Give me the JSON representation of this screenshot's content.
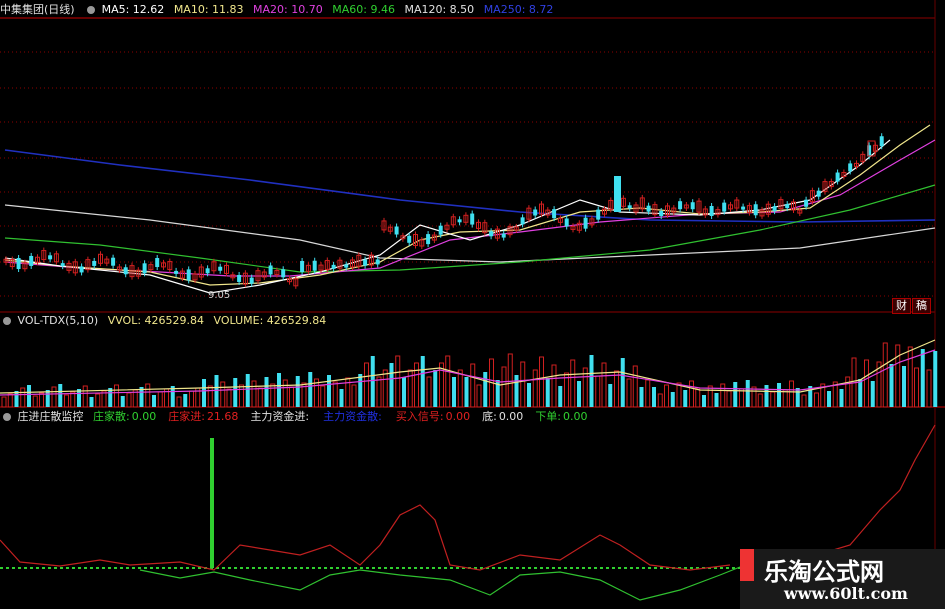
{
  "colors": {
    "ma5": "#ffffff",
    "ma10": "#f0e68c",
    "ma20": "#e040e0",
    "ma60": "#30c030",
    "ma120": "#d8d8d8",
    "ma250": "#2030c0",
    "up": "#d02020",
    "down": "#40e0f0",
    "grid": "#8b0000"
  },
  "price_panel": {
    "stock_name": "中集集团(日线)",
    "ma_labels": [
      {
        "key": "ma5",
        "text": "MA5: 12.62"
      },
      {
        "key": "ma10",
        "text": "MA10: 11.83"
      },
      {
        "key": "ma20",
        "text": "MA20: 10.70"
      },
      {
        "key": "ma60",
        "text": "MA60: 9.46"
      },
      {
        "key": "ma120",
        "text": "MA120: 8.50"
      },
      {
        "key": "ma250",
        "text": "MA250: 8.72"
      }
    ],
    "low_mark": "9.05",
    "tags": [
      "财",
      "稿"
    ]
  },
  "volume_panel": {
    "indicator": "VOL-TDX(5,10)",
    "vvol": "VVOL: 426529.84",
    "volume": "VOLUME: 426529.84"
  },
  "monitor_panel": {
    "indicator": "庄进庄散监控",
    "items": [
      {
        "label": "庄家散:",
        "value": "0.00",
        "color": "#30d030"
      },
      {
        "label": "庄家进:",
        "value": "21.68",
        "color": "#e02020"
      },
      {
        "label": "主力资金进:",
        "value": "",
        "color": "#e0e0e0"
      },
      {
        "label": "主力资金散:",
        "value": "",
        "color": "#2030e0"
      },
      {
        "label": "买入信号:",
        "value": "0.00",
        "color": "#e02020"
      },
      {
        "label": "底:",
        "value": "0.00",
        "color": "#e0e0e0"
      },
      {
        "label": "下单:",
        "value": "0.00",
        "color": "#30d030"
      }
    ]
  },
  "watermark": {
    "title": "乐淘公式网",
    "url": "www.60lt.com"
  },
  "chart_data": {
    "type": "candlestick",
    "ma_last": {
      "MA5": 12.62,
      "MA10": 11.83,
      "MA20": 10.7,
      "MA60": 9.46,
      "MA120": 8.5,
      "MA250": 8.72
    },
    "volume_last": 426529.84,
    "monitor_values": {
      "庄家散": 0.0,
      "庄家进": 21.68,
      "买入信号": 0.0,
      "底": 0.0,
      "下单": 0.0
    }
  }
}
